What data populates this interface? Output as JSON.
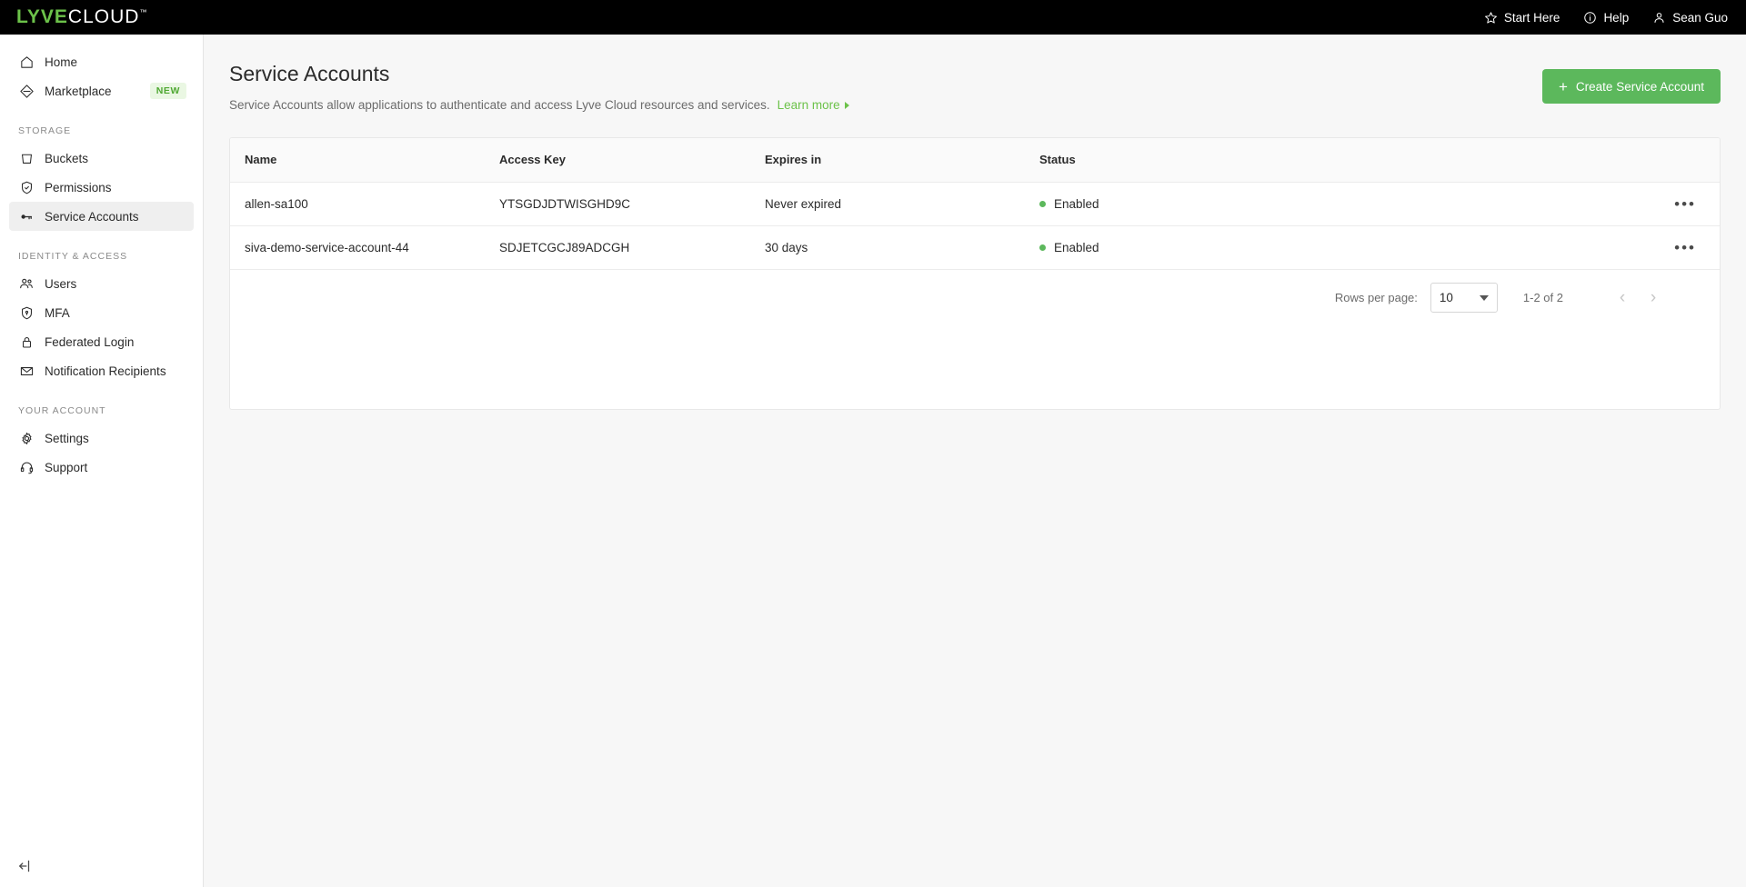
{
  "topbar": {
    "logo": {
      "primary": "LYVE",
      "secondary": "CLOUD",
      "tm": "™"
    },
    "nav": [
      {
        "icon": "star-icon",
        "label": "Start Here"
      },
      {
        "icon": "info-circle-icon",
        "label": "Help"
      },
      {
        "icon": "user-icon",
        "label": "Sean Guo"
      }
    ]
  },
  "sidebar": {
    "items": [
      {
        "label": "Home",
        "icon": "home-icon",
        "active": false
      },
      {
        "label": "Marketplace",
        "icon": "diamond-icon",
        "active": false,
        "badge": "NEW"
      }
    ],
    "sections": [
      {
        "title": "STORAGE",
        "items": [
          {
            "label": "Buckets",
            "icon": "bucket-icon",
            "active": false
          },
          {
            "label": "Permissions",
            "icon": "shield-check-icon",
            "active": false
          },
          {
            "label": "Service Accounts",
            "icon": "key-icon",
            "active": true
          }
        ]
      },
      {
        "title": "IDENTITY & ACCESS",
        "items": [
          {
            "label": "Users",
            "icon": "users-icon",
            "active": false
          },
          {
            "label": "MFA",
            "icon": "shield-icon",
            "active": false
          },
          {
            "label": "Federated Login",
            "icon": "lock-icon",
            "active": false
          },
          {
            "label": "Notification Recipients",
            "icon": "envelope-icon",
            "active": false
          }
        ]
      },
      {
        "title": "YOUR ACCOUNT",
        "items": [
          {
            "label": "Settings",
            "icon": "gear-icon",
            "active": false
          },
          {
            "label": "Support",
            "icon": "headset-icon",
            "active": false
          }
        ]
      }
    ],
    "collapse_icon": "collapse-sidebar-icon"
  },
  "page": {
    "title": "Service Accounts",
    "subtitle": "Service Accounts allow applications to authenticate and access Lyve Cloud resources and services.",
    "learn_more": "Learn more",
    "create_button": "Create Service Account",
    "create_button_icon": "plus-icon"
  },
  "table": {
    "columns": [
      "Name",
      "Access Key",
      "Expires in",
      "Status"
    ],
    "rows": [
      {
        "name": "allen-sa100",
        "access_key": "YTSGDJDTWISGHD9C",
        "expires_in": "Never expired",
        "status": "Enabled",
        "actions_icon": "ellipsis-icon"
      },
      {
        "name": "siva-demo-service-account-44",
        "access_key": "SDJETCGCJ89ADCGH",
        "expires_in": "30 days",
        "status": "Enabled",
        "actions_icon": "ellipsis-icon"
      }
    ]
  },
  "pagination": {
    "rows_per_page_label": "Rows per page:",
    "rows_per_page_value": "10",
    "range": "1-2 of 2",
    "prev_icon": "chevron-left-icon",
    "next_icon": "chevron-right-icon",
    "prev_glyph": "‹",
    "next_glyph": "›"
  },
  "colors": {
    "brand_green": "#6cc24a",
    "button_green": "#5cb85c",
    "status_green": "#5cb85c",
    "topbar_black": "#000000",
    "page_bg": "#f7f7f7"
  }
}
